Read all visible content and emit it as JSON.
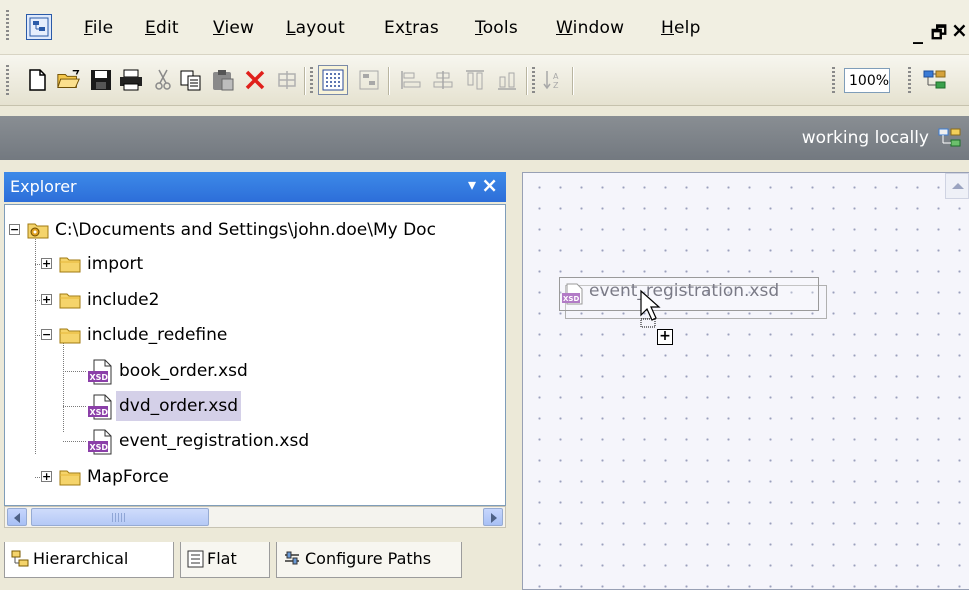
{
  "menu": {
    "items": [
      "File",
      "Edit",
      "View",
      "Layout",
      "Extras",
      "Tools",
      "Window",
      "Help"
    ],
    "mnemonics": [
      "F",
      "E",
      "V",
      "L",
      "t",
      "T",
      "W",
      "H"
    ]
  },
  "window_controls": {
    "minimize": "_",
    "restore": "🗗",
    "close": "×"
  },
  "toolbar": {
    "zoom_value": "100%"
  },
  "status": {
    "working_text": "working locally"
  },
  "explorer": {
    "title": "Explorer",
    "pin_glyph": "▾",
    "close_glyph": "×",
    "tree": [
      {
        "label": "C:\\Documents and Settings\\john.doe\\My Doc",
        "type": "root",
        "expander": "−"
      },
      {
        "label": "import",
        "type": "folder",
        "expander": "+"
      },
      {
        "label": "include2",
        "type": "folder",
        "expander": "+"
      },
      {
        "label": "include_redefine",
        "type": "folder",
        "expander": "−"
      },
      {
        "label": "book_order.xsd",
        "type": "xsd"
      },
      {
        "label": "dvd_order.xsd",
        "type": "xsd",
        "selected": true
      },
      {
        "label": "event_registration.xsd",
        "type": "xsd"
      },
      {
        "label": "MapForce",
        "type": "folder",
        "expander": "+"
      }
    ],
    "tabs": [
      "Hierarchical",
      "Flat",
      "Configure Paths"
    ]
  },
  "canvas": {
    "drag_item_label": "event_registration.xsd",
    "drag_plus": "+"
  },
  "colors": {
    "accent": "#2d6ed9",
    "selection": "#d4d0e8",
    "folder": "#f5d46b",
    "xsd": "#8b3fa8"
  }
}
